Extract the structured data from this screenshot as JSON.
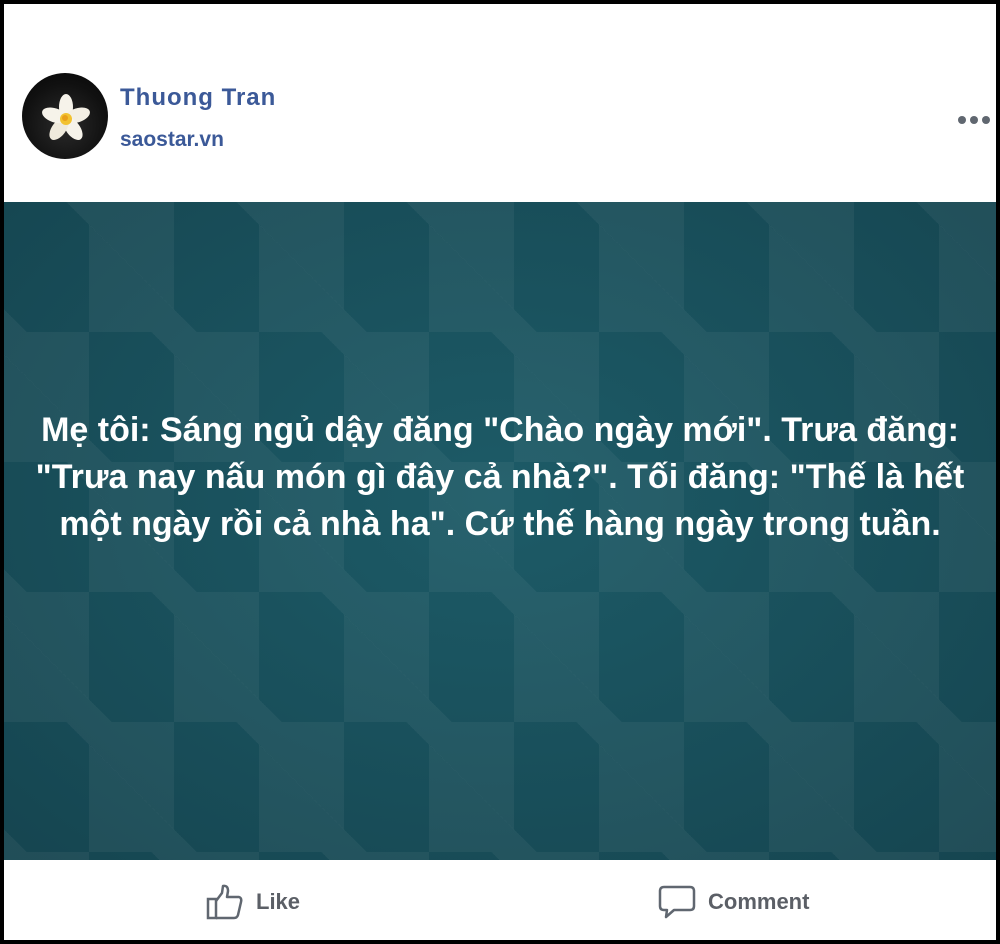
{
  "post": {
    "author_name": "Thuong Tran",
    "source": "saostar.vn",
    "status_text": "Mẹ tôi: Sáng ngủ dậy đăng \"Chào ngày mới\". Trưa đăng: \"Trưa nay nấu món gì đây cả nhà?\". Tối đăng: \"Thế là hết một ngày rồi cả nhà ha\". Cứ thế hàng ngày trong tuần."
  },
  "actions": {
    "like_label": "Like",
    "comment_label": "Comment"
  },
  "icons": {
    "avatar": "plumeria-flower-icon",
    "more": "more-options-icon",
    "like": "thumbs-up-icon",
    "comment": "speech-bubble-icon"
  },
  "colors": {
    "author_link": "#3b5998",
    "background_teal": "#19515e",
    "action_text": "#5b5f66",
    "border": "#000000"
  }
}
